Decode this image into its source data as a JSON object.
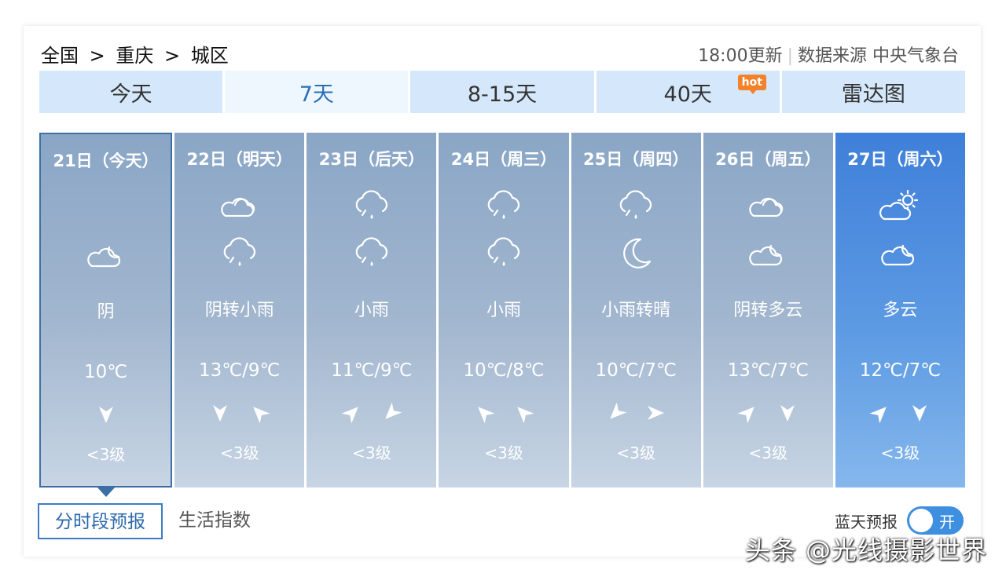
{
  "breadcrumb": {
    "country": "全国",
    "sep1": ">",
    "city": "重庆",
    "sep2": ">",
    "district": "城区"
  },
  "update": {
    "time": "18:00更新",
    "source": "数据来源 中央气象台"
  },
  "tabs": [
    {
      "label": "今天"
    },
    {
      "label": "7天",
      "active": true
    },
    {
      "label": "8-15天"
    },
    {
      "label": "40天",
      "badge": "hot"
    },
    {
      "label": "雷达图"
    }
  ],
  "days": [
    {
      "date": "21日（今天）",
      "icon_top": "",
      "icon_bottom": "cloudy-night-icon",
      "desc": "阴",
      "temp": "10℃",
      "wind_dirs": [
        "south"
      ],
      "level": "<3级"
    },
    {
      "date": "22日（明天）",
      "icon_top": "overcast-icon",
      "icon_bottom": "rain-icon",
      "desc": "阴转小雨",
      "temp": "13℃/9℃",
      "wind_dirs": [
        "south",
        "northwest"
      ],
      "level": "<3级"
    },
    {
      "date": "23日（后天）",
      "icon_top": "rain-icon",
      "icon_bottom": "rain-icon",
      "desc": "小雨",
      "temp": "11℃/9℃",
      "wind_dirs": [
        "northeast",
        "southwest"
      ],
      "level": "<3级"
    },
    {
      "date": "24日（周三）",
      "icon_top": "rain-icon",
      "icon_bottom": "rain-icon",
      "desc": "小雨",
      "temp": "10℃/8℃",
      "wind_dirs": [
        "northwest",
        "northwest"
      ],
      "level": "<3级"
    },
    {
      "date": "25日（周四）",
      "icon_top": "rain-icon",
      "icon_bottom": "moon-icon",
      "desc": "小雨转晴",
      "temp": "10℃/7℃",
      "wind_dirs": [
        "southwest",
        "east"
      ],
      "level": "<3级"
    },
    {
      "date": "26日（周五）",
      "icon_top": "overcast-icon",
      "icon_bottom": "cloudy-night-icon",
      "desc": "阴转多云",
      "temp": "13℃/7℃",
      "wind_dirs": [
        "northeast",
        "south"
      ],
      "level": "<3级"
    },
    {
      "date": "27日（周六）",
      "icon_top": "partly-sunny-icon",
      "icon_bottom": "cloudy-night-icon",
      "desc": "多云",
      "temp": "12℃/7℃",
      "wind_dirs": [
        "northeast",
        "south"
      ],
      "level": "<3级"
    }
  ],
  "bottom_tabs": [
    {
      "label": "分时段预报",
      "active": true
    },
    {
      "label": "生活指数"
    }
  ],
  "blue_sky": {
    "label": "蓝天预报",
    "toggle": "开"
  },
  "watermark": "头条 @光线摄影世界",
  "colors": {
    "card": "#8aa6c6",
    "highlight": "#3f7fd9",
    "tab": "#d5e8fb",
    "accent": "#2a6fb8",
    "hot": "#f5822a"
  }
}
